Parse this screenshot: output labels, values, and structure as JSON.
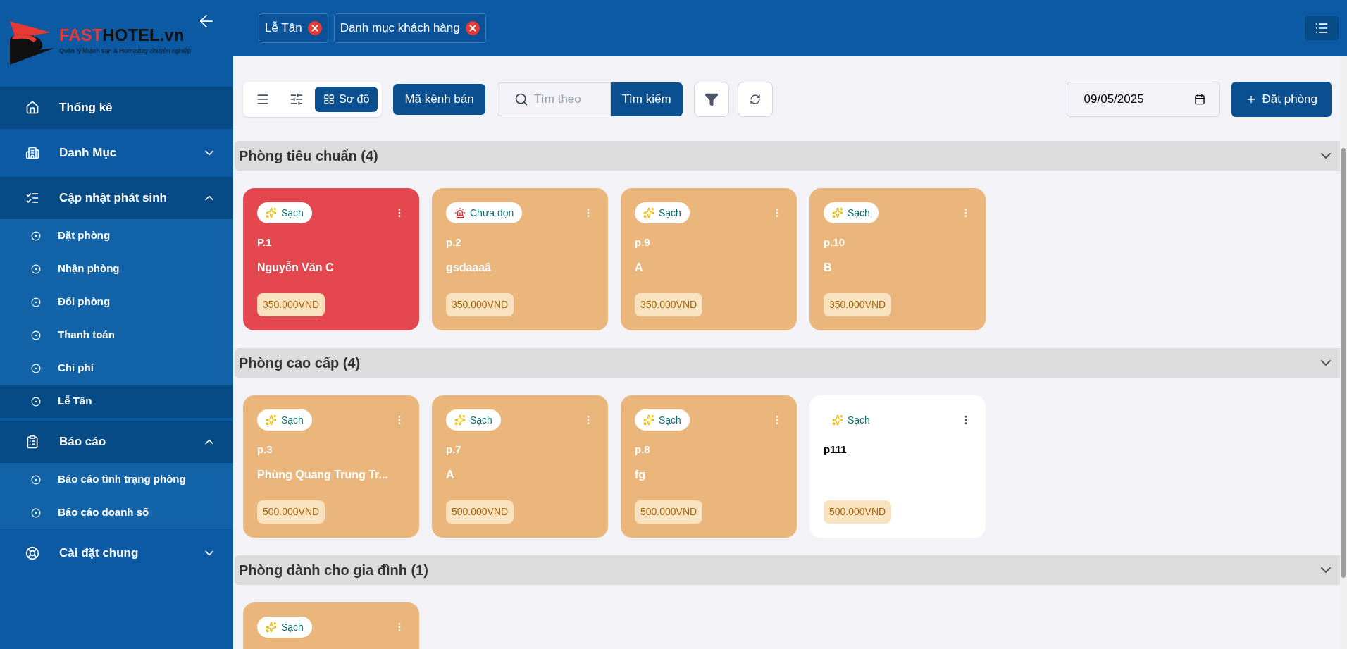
{
  "logo": {
    "brand_part_1": "FAST",
    "brand_part_2": "HOTEL.vn",
    "tagline": "Quản lý khách sạn & Homestay chuyên nghiệp"
  },
  "sidebar": {
    "items": [
      {
        "label": "Thống kê",
        "selected": true
      },
      {
        "label": "Danh Mục",
        "expanded": false
      },
      {
        "label": "Cập nhật phát sinh",
        "expanded": true,
        "children": [
          {
            "label": "Đặt phòng",
            "selected": false
          },
          {
            "label": "Nhận phòng",
            "selected": false
          },
          {
            "label": "Đổi phòng",
            "selected": false
          },
          {
            "label": "Thanh toán",
            "selected": false
          },
          {
            "label": "Chi phí",
            "selected": false
          },
          {
            "label": "Lễ Tân",
            "selected": true
          }
        ]
      },
      {
        "label": "Báo cáo",
        "expanded": true,
        "children": [
          {
            "label": "Báo cáo tình trạng phòng",
            "selected": false
          },
          {
            "label": "Báo cáo doanh số",
            "selected": false
          }
        ]
      },
      {
        "label": "Cài đặt chung",
        "expanded": false
      }
    ]
  },
  "open_tabs": [
    {
      "label": "Lễ Tân"
    },
    {
      "label": "Danh mục khách hàng"
    }
  ],
  "toolbar": {
    "views": [
      {
        "kind": "list",
        "selected": false
      },
      {
        "kind": "settings",
        "selected": false
      },
      {
        "kind": "grid",
        "label": "Sơ đồ",
        "selected": true
      }
    ],
    "channel_button": "Mã kênh bán",
    "search": {
      "placeholder": "Tìm theo"
    },
    "search_button": "Tìm kiếm",
    "date": "09/05/2025",
    "book_button": "Đặt phòng"
  },
  "groups": [
    {
      "title": "Phòng tiêu chuẩn (4)",
      "rooms": [
        {
          "color": "#e5474f",
          "status": {
            "kind": "clean",
            "label": "Sạch"
          },
          "room": "P.1",
          "guest": "Nguyễn Văn C",
          "price": "350.000VND"
        },
        {
          "color": "#ebb67b",
          "status": {
            "kind": "dirty",
            "label": "Chưa dọn"
          },
          "room": "p.2",
          "guest": "gsdaaaâ",
          "price": "350.000VND"
        },
        {
          "color": "#ebb67b",
          "status": {
            "kind": "clean",
            "label": "Sạch"
          },
          "room": "p.9",
          "guest": "A",
          "price": "350.000VND"
        },
        {
          "color": "#ebb67b",
          "status": {
            "kind": "clean",
            "label": "Sạch"
          },
          "room": "p.10",
          "guest": "B",
          "price": "350.000VND"
        }
      ]
    },
    {
      "title": "Phòng cao cấp (4)",
      "rooms": [
        {
          "color": "#ebb67b",
          "status": {
            "kind": "clean",
            "label": "Sạch"
          },
          "room": "p.3",
          "guest": "Phùng Quang Trung Tr...",
          "price": "500.000VND"
        },
        {
          "color": "#ebb67b",
          "status": {
            "kind": "clean",
            "label": "Sạch"
          },
          "room": "p.7",
          "guest": "A",
          "price": "500.000VND"
        },
        {
          "color": "#ebb67b",
          "status": {
            "kind": "clean",
            "label": "Sạch"
          },
          "room": "p.8",
          "guest": "fg",
          "price": "500.000VND"
        },
        {
          "color": "#ffffff",
          "status": {
            "kind": "clean",
            "label": "Sạch"
          },
          "room": "p111",
          "price": "500.000VND"
        }
      ]
    },
    {
      "title": "Phòng dành cho gia đình (1)",
      "rooms": [
        {
          "color": "#ebb67b",
          "status": {
            "kind": "clean",
            "label": "Sạch"
          }
        }
      ]
    }
  ]
}
